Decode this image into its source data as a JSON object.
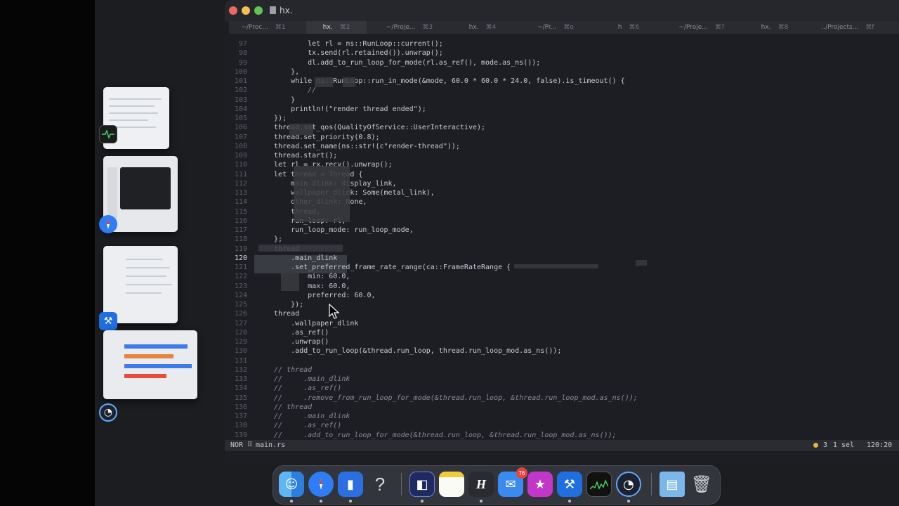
{
  "window": {
    "title": "hx.",
    "traffic_colors": {
      "close": "#ed6a5e",
      "minimize": "#f5bf4f",
      "zoom": "#61c554"
    }
  },
  "tabs": [
    {
      "label": "~/Proc...",
      "shortcut": "⌘1",
      "active": false
    },
    {
      "label": "hx.",
      "shortcut": "⌘2",
      "active": true
    },
    {
      "label": "~/Proje...",
      "shortcut": "⌘3",
      "active": false
    },
    {
      "label": "hx.",
      "shortcut": "⌘4",
      "active": false
    },
    {
      "label": "~/Pr...",
      "shortcut": "⌘o",
      "active": false
    },
    {
      "label": "h",
      "shortcut": "⌘6",
      "active": false
    },
    {
      "label": "~/Proje...",
      "shortcut": "⌘?",
      "active": false
    },
    {
      "label": "hx.",
      "shortcut": "⌘8",
      "active": false
    },
    {
      "label": "../Projects...",
      "shortcut": "⌘f",
      "active": false
    }
  ],
  "code_lines": [
    {
      "n": "97",
      "text": "        let rl = ns::RunLoop::current();"
    },
    {
      "n": "98",
      "text": "        tx.send(rl.retained()).unwrap();"
    },
    {
      "n": "99",
      "text": "        dl.add_to_run_loop_for_mode(rl.as_ref(), mode.as_ns());"
    },
    {
      "n": "100",
      "text": "    },"
    },
    {
      "n": "101",
      "text": "    while ns::RunLoop::run_in_mode(&mode, 60.0 * 60.0 * 24.0, false).is_timeout() {"
    },
    {
      "n": "102",
      "text": "        //"
    },
    {
      "n": "103",
      "text": "    }"
    },
    {
      "n": "104",
      "text": "    println!(\"render thread ended\");"
    },
    {
      "n": "105",
      "text": "});"
    },
    {
      "n": "106",
      "text": "thread.set_qos(QualityOfService::UserInteractive);"
    },
    {
      "n": "107",
      "text": "thread.set_priority(0.8);"
    },
    {
      "n": "108",
      "text": "thread.set_name(ns::str!(c\"render-thread\"));"
    },
    {
      "n": "109",
      "text": "thread.start();"
    },
    {
      "n": "110",
      "text": "let rl = rx.recv().unwrap();"
    },
    {
      "n": "111",
      "text": "let thread = Thread {"
    },
    {
      "n": "112",
      "text": "    main_dlink: display_link,"
    },
    {
      "n": "113",
      "text": "    wallpaper_dlink: Some(metal_link),"
    },
    {
      "n": "114",
      "text": "    other_dlink: None,"
    },
    {
      "n": "115",
      "text": "    thread,"
    },
    {
      "n": "116",
      "text": "    run_loop: rl,"
    },
    {
      "n": "117",
      "text": "    run_loop_mode: run_loop_mode,"
    },
    {
      "n": "118",
      "text": "};"
    },
    {
      "n": "119",
      "text": "thread"
    },
    {
      "n": "120",
      "text": "    .main_dlink"
    },
    {
      "n": "121",
      "text": "    .set_preferred_frame_rate_range(ca::FrameRateRange {"
    },
    {
      "n": "122",
      "text": "        min: 60.0,"
    },
    {
      "n": "123",
      "text": "        max: 60.0,"
    },
    {
      "n": "124",
      "text": "        preferred: 60.0,"
    },
    {
      "n": "125",
      "text": "    });"
    },
    {
      "n": "126",
      "text": "thread"
    },
    {
      "n": "127",
      "text": "    .wallpaper_dlink"
    },
    {
      "n": "128",
      "text": "    .as_ref()"
    },
    {
      "n": "129",
      "text": "    .unwrap()"
    },
    {
      "n": "130",
      "text": "    .add_to_run_loop(&thread.run_loop, thread.run_loop_mod.as_ns());"
    },
    {
      "n": "131",
      "text": ""
    },
    {
      "n": "132",
      "text": "// thread"
    },
    {
      "n": "133",
      "text": "//     .main_dlink"
    },
    {
      "n": "134",
      "text": "//     .as_ref()"
    },
    {
      "n": "135",
      "text": "//     .remove_from_run_loop_for_mode(&thread.run_loop, &thread.run_loop_mod.as_ns());"
    },
    {
      "n": "136",
      "text": "// thread"
    },
    {
      "n": "137",
      "text": "//     .main_dlink"
    },
    {
      "n": "138",
      "text": "//     .as_ref()"
    },
    {
      "n": "139",
      "text": "//     .add_to_run_loop_for_mode(&thread.run_loop, &thread.run_loop_mod.as_ns());"
    }
  ],
  "status": {
    "mode": "NOR",
    "separator": "⠿",
    "file": "main.rs",
    "diagnostics": "3",
    "selections": "1 sel",
    "position": "120:20"
  },
  "dock": {
    "mail_badge": "76",
    "help_glyph": "?",
    "apps": [
      "finder-icon",
      "safari-icon",
      "xcode-icon",
      "help-icon",
      "preview-icon",
      "notes-icon",
      "helix-icon",
      "mail-icon",
      "superstar-icon",
      "xcode-beta-icon",
      "activity-monitor-icon",
      "instruments-icon",
      "downloads-folder-icon",
      "trash-icon"
    ]
  }
}
